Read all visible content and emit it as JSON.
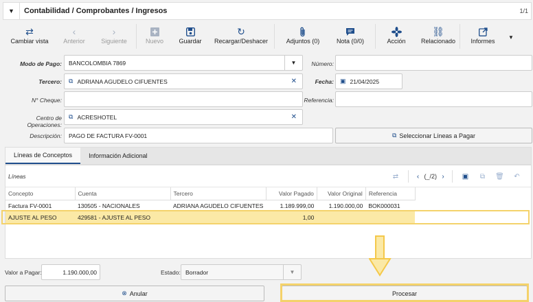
{
  "header": {
    "title": "Contabilidad / Comprobantes / Ingresos",
    "pager": "1/1"
  },
  "toolbar": {
    "buttons": [
      {
        "label": "Cambiar vista",
        "icon": "switch-view-icon"
      },
      {
        "label": "Anterior",
        "icon": "chevron-left-icon"
      },
      {
        "label": "Siguiente",
        "icon": "chevron-right-icon"
      },
      {
        "label": "Nuevo",
        "icon": "plus-square-icon"
      },
      {
        "label": "Guardar",
        "icon": "save-icon"
      },
      {
        "label": "Recargar/Deshacer",
        "icon": "reload-icon"
      },
      {
        "label": "Adjuntos (0)",
        "icon": "paperclip-icon"
      },
      {
        "label": "Nota (0/0)",
        "icon": "note-icon"
      },
      {
        "label": "Acción",
        "icon": "fan-icon"
      },
      {
        "label": "Relacionado",
        "icon": "link-icon"
      },
      {
        "label": "Informes",
        "icon": "report-icon"
      }
    ]
  },
  "form": {
    "modo_pago": {
      "label": "Modo de Pago:",
      "value": "BANCOLOMBIA 7869"
    },
    "numero": {
      "label": "Número:",
      "value": ""
    },
    "tercero": {
      "label": "Tercero:",
      "value": "ADRIANA AGUDELO CIFUENTES"
    },
    "fecha": {
      "label": "Fecha:",
      "value": "21/04/2025"
    },
    "cheque": {
      "label": "N° Cheque:",
      "value": ""
    },
    "referencia": {
      "label": "Referencia:",
      "value": ""
    },
    "centro": {
      "label": "Centro de Operaciones:",
      "value": "ACRESHOTEL"
    },
    "descripcion": {
      "label": "Descripción:",
      "value": "PAGO DE FACTURA FV-0001"
    },
    "select_lines_label": "Seleccionar Líneas a Pagar"
  },
  "tabs": [
    {
      "label": "Líneas de Conceptos"
    },
    {
      "label": "Información Adicional"
    }
  ],
  "grid": {
    "title": "Líneas",
    "pager": "(_/2)",
    "columns": [
      "Concepto",
      "Cuenta",
      "Tercero",
      "Valor Pagado",
      "Valor Original",
      "Referencia"
    ],
    "rows": [
      [
        "Factura FV-0001",
        "130505 - NACIONALES",
        "ADRIANA AGUDELO CIFUENTES",
        "1.189.999,00",
        "1.190.000,00",
        "BOK000031"
      ],
      [
        "AJUSTE AL PESO",
        "429581 - AJUSTE AL PESO",
        "",
        "1,00",
        "",
        ""
      ]
    ]
  },
  "footer": {
    "valor_label": "Valor a Pagar:",
    "valor_value": "1.190.000,00",
    "estado_label": "Estado:",
    "estado_value": "Borrador",
    "anular_label": "Anular",
    "procesar_label": "Procesar"
  },
  "colors": {
    "accent": "#1f4e8c",
    "highlight": "#f4d26a",
    "selected_row": "#fbe9a6"
  }
}
